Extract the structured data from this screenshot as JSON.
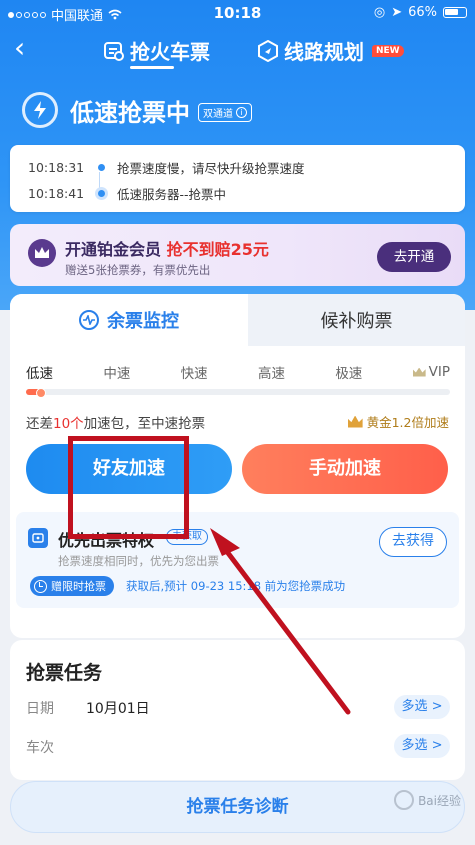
{
  "status_bar": {
    "carrier": "中国联通",
    "time": "10:18",
    "battery": "66%"
  },
  "nav": {
    "tab_active": "抢火车票",
    "tab_other": "线路规划",
    "new_badge": "NEW"
  },
  "header": {
    "title": "低速抢票中",
    "channel_tag": "双通道"
  },
  "log": [
    {
      "time": "10:18:31",
      "text": "抢票速度慢，请尽快升级抢票速度"
    },
    {
      "time": "10:18:41",
      "text": "低速服务器--抢票中"
    }
  ],
  "vip_banner": {
    "title_a": "开通铂金会员 ",
    "title_b": "抢不到赔25元",
    "subtitle": "赠送5张抢票券，有票优先出",
    "button": "去开通"
  },
  "monitor": {
    "tab_active": "余票监控",
    "tab_other": "候补购票",
    "speed_levels": [
      "低速",
      "中速",
      "快速",
      "高速",
      "极速",
      "VIP"
    ],
    "progress_fraction": 0.04,
    "need_prefix": "还差",
    "need_count": "10个",
    "need_suffix": "加速包，至中速抢票",
    "gold_note": "黄金1.2倍加速",
    "friend_button": "好友加速",
    "manual_button": "手动加速"
  },
  "privilege": {
    "title": "优先出票特权",
    "tag": "未获取",
    "subtitle": "抢票速度相同时，优先为您出票",
    "button": "去获得",
    "limited_label": "赠限时抢票",
    "limited_desc": "获取后,预计 09-23 15:18 前为您抢票成功"
  },
  "task": {
    "title": "抢票任务",
    "rows": [
      {
        "key": "日期",
        "value": "10月01日",
        "action": "多选 >"
      },
      {
        "key": "车次",
        "value": "",
        "action": "多选 >"
      }
    ]
  },
  "bottom_button": "抢票任务诊断",
  "watermark": "Bai经验",
  "colors": {
    "primary": "#2a80ea",
    "accent_red": "#e8312f",
    "annotation": "#c0111f"
  }
}
